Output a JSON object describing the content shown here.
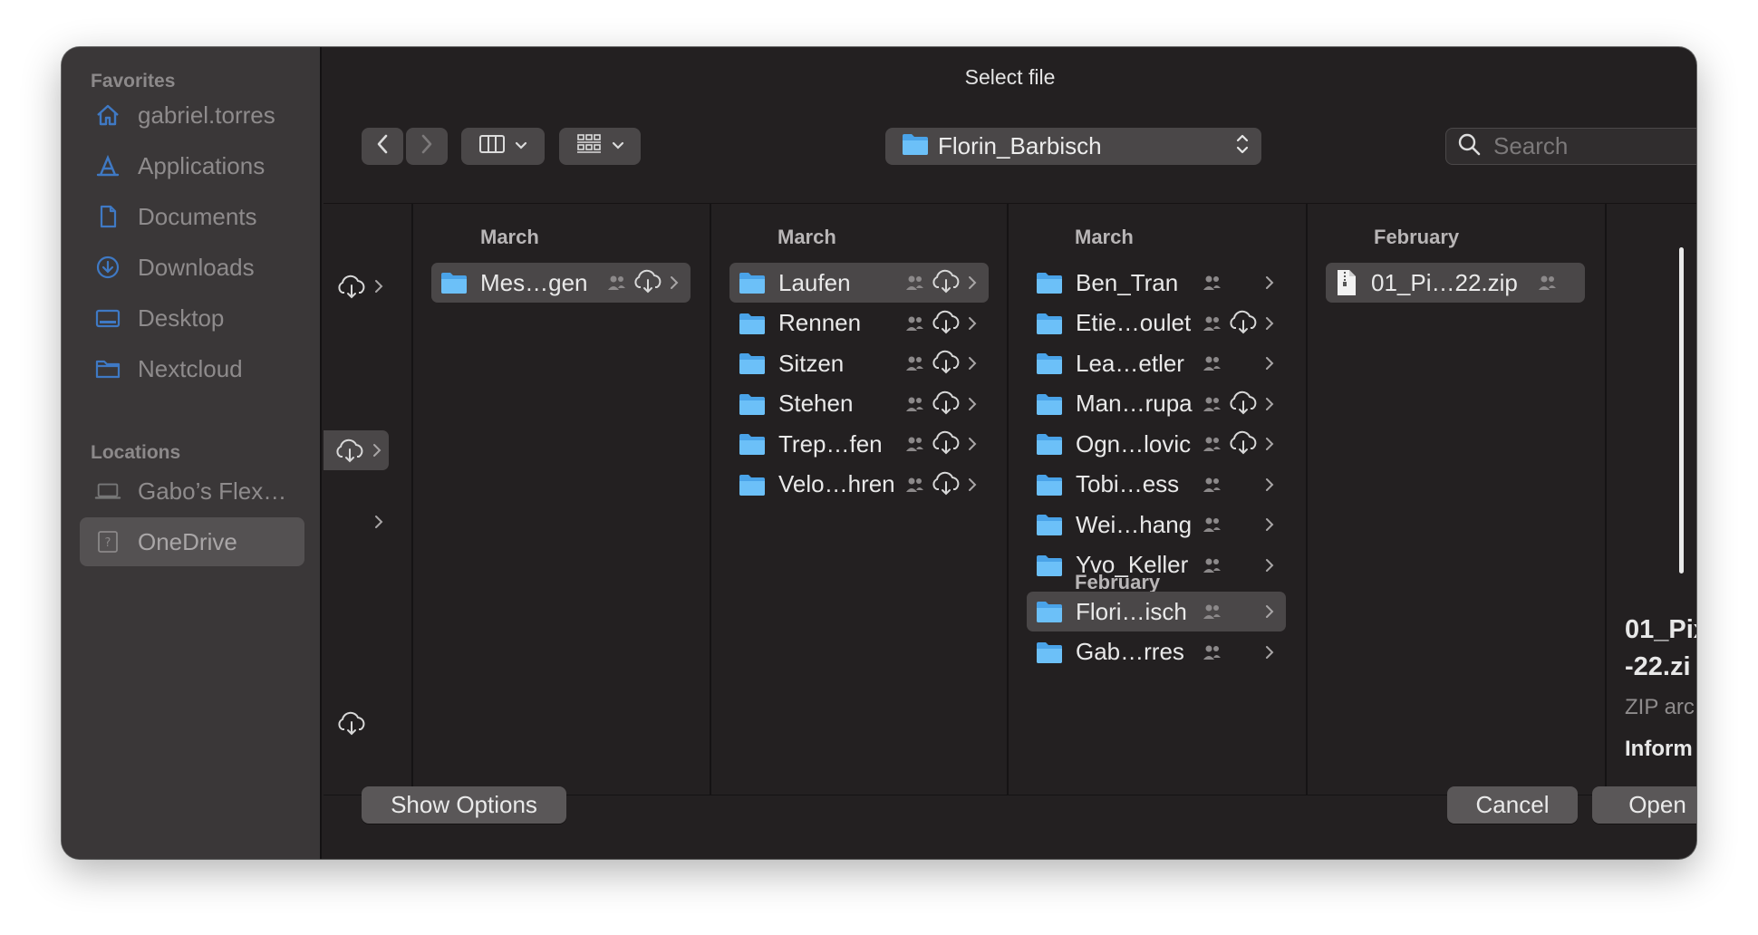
{
  "window": {
    "title": "Select file"
  },
  "sidebar": {
    "favorites_heading": "Favorites",
    "favorites": [
      {
        "label": "gabriel.torres",
        "icon": "home-icon"
      },
      {
        "label": "Applications",
        "icon": "applications-icon"
      },
      {
        "label": "Documents",
        "icon": "document-icon"
      },
      {
        "label": "Downloads",
        "icon": "download-icon"
      },
      {
        "label": "Desktop",
        "icon": "desktop-icon"
      },
      {
        "label": "Nextcloud",
        "icon": "folder-icon"
      }
    ],
    "locations_heading": "Locations",
    "locations": [
      {
        "label": "Gabo’s Flex…",
        "icon": "laptop-icon"
      },
      {
        "label": "OneDrive",
        "icon": "question-drive-icon",
        "selected": true
      }
    ]
  },
  "toolbar": {
    "back": "back-icon",
    "forward": "forward-icon",
    "view_mode": "columns-view-icon",
    "group_mode": "grid-group-icon",
    "path": "Florin_Barbisch",
    "search_placeholder": "Search"
  },
  "columns": [
    {
      "header": "March",
      "items": [
        {
          "name": "Mes…gen",
          "shared": true,
          "cloud": true,
          "selected": true
        }
      ]
    },
    {
      "header": "March",
      "items": [
        {
          "name": "Laufen",
          "shared": true,
          "cloud": true,
          "selected": true
        },
        {
          "name": "Rennen",
          "shared": true,
          "cloud": true
        },
        {
          "name": "Sitzen",
          "shared": true,
          "cloud": true
        },
        {
          "name": "Stehen",
          "shared": true,
          "cloud": true
        },
        {
          "name": "Trep…fen",
          "shared": true,
          "cloud": true
        },
        {
          "name": "Velo…hren",
          "shared": true,
          "cloud": true
        }
      ]
    },
    {
      "header": "March",
      "items": [
        {
          "name": "Ben_Tran",
          "shared": true,
          "cloud": false
        },
        {
          "name": "Etie…oulet",
          "shared": true,
          "cloud": true
        },
        {
          "name": "Lea…etler",
          "shared": true,
          "cloud": false
        },
        {
          "name": "Man…rupa",
          "shared": true,
          "cloud": true
        },
        {
          "name": "Ogn…lovic",
          "shared": true,
          "cloud": true
        },
        {
          "name": "Tobi…ess",
          "shared": true,
          "cloud": false
        },
        {
          "name": "Wei…hang",
          "shared": true,
          "cloud": false
        },
        {
          "name": "Yvo_Keller",
          "shared": true,
          "cloud": false
        }
      ],
      "subheader": "February",
      "items2": [
        {
          "name": "Flori…isch",
          "shared": true,
          "cloud": false,
          "selected": true
        },
        {
          "name": "Gab…rres",
          "shared": true,
          "cloud": false
        }
      ]
    },
    {
      "header": "February",
      "items": [
        {
          "name": "01_Pi…22.zip",
          "shared": true,
          "file": true,
          "selected": true
        }
      ]
    }
  ],
  "preview": {
    "name_line1": "01_Pix",
    "name_line2": "-22.zi",
    "kind": "ZIP arc",
    "info": "Inform"
  },
  "buttons": {
    "show_options": "Show Options",
    "cancel": "Cancel",
    "open": "Open"
  },
  "colors": {
    "folder_blue": "#5ab3f2",
    "window_bg": "#232021",
    "sidebar_bg": "#3a3738"
  }
}
